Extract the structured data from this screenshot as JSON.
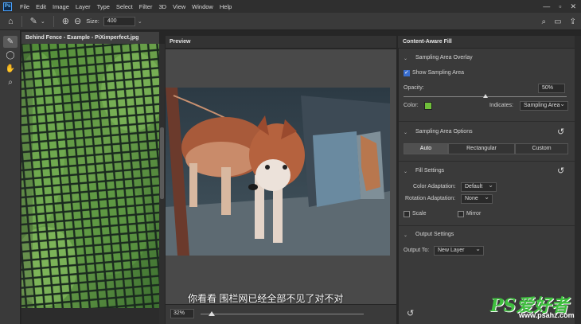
{
  "app": {
    "logo": "Ps"
  },
  "menu": [
    "File",
    "Edit",
    "Image",
    "Layer",
    "Type",
    "Select",
    "Filter",
    "3D",
    "View",
    "Window",
    "Help"
  ],
  "window_controls": [
    "—",
    "▫",
    "✕"
  ],
  "options_bar": {
    "size_label": "Size:",
    "size_value": "400"
  },
  "document": {
    "tab_title": "Behind Fence - Example - PiXimperfect.jpg"
  },
  "preview": {
    "title": "Preview",
    "zoom": "32%",
    "subtitle": "你看看 围栏网已经全部不见了对不对"
  },
  "panel": {
    "title": "Content-Aware Fill",
    "sampling_overlay": {
      "header": "Sampling Area Overlay",
      "show_label": "Show Sampling Area",
      "show_checked": true,
      "opacity_label": "Opacity:",
      "opacity_value": "50%",
      "opacity_fraction": 0.5,
      "color_label": "Color:",
      "color": "#6fbf3a",
      "indicates_label": "Indicates:",
      "indicates_value": "Sampling Area"
    },
    "sampling_options": {
      "header": "Sampling Area Options",
      "buttons": [
        "Auto",
        "Rectangular",
        "Custom"
      ],
      "active": "Auto"
    },
    "fill_settings": {
      "header": "Fill Settings",
      "color_adaptation_label": "Color Adaptation:",
      "color_adaptation_value": "Default",
      "rotation_adaptation_label": "Rotation Adaptation:",
      "rotation_adaptation_value": "None",
      "scale_label": "Scale",
      "mirror_label": "Mirror"
    },
    "output_settings": {
      "header": "Output Settings",
      "output_to_label": "Output To:",
      "output_to_value": "New Layer"
    }
  },
  "watermark": {
    "brand": "PS爱好者",
    "url": "www.psahz.com"
  }
}
